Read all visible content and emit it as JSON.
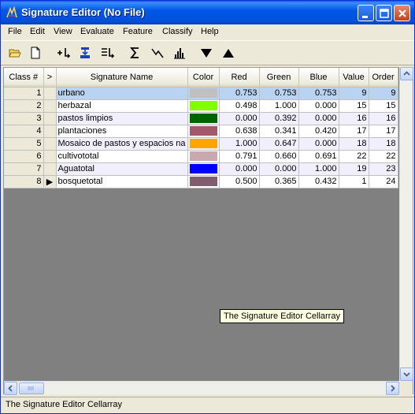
{
  "window": {
    "title": "Signature Editor (No File)",
    "icons": {
      "app": "signature-editor-app-icon",
      "minimize": "minimize-icon",
      "maximize": "maximize-icon",
      "close": "close-icon"
    }
  },
  "menu": [
    "File",
    "Edit",
    "View",
    "Evaluate",
    "Feature",
    "Classify",
    "Help"
  ],
  "toolbar": {
    "icons": [
      "open-folder-icon",
      "new-document-icon",
      "add-class-icon",
      "merge-icon",
      "replace-icon",
      "statistics-sigma-icon",
      "mean-plot-icon",
      "histogram-icon",
      "move-down-icon",
      "move-up-icon"
    ]
  },
  "grid": {
    "columns": [
      "Class #",
      ">",
      "Signature Name",
      "Color",
      "Red",
      "Green",
      "Blue",
      "Value",
      "Order"
    ],
    "rows": [
      {
        "class": "1",
        "marker": "",
        "name": "urbano",
        "color": "#C0C0C0",
        "red": "0.753",
        "green": "0.753",
        "blue": "0.753",
        "value": "9",
        "order": "9"
      },
      {
        "class": "2",
        "marker": "",
        "name": "herbazal",
        "color": "#7FFF00",
        "red": "0.498",
        "green": "1.000",
        "blue": "0.000",
        "value": "15",
        "order": "15"
      },
      {
        "class": "3",
        "marker": "",
        "name": "pastos limpios",
        "color": "#006400",
        "red": "0.000",
        "green": "0.392",
        "blue": "0.000",
        "value": "16",
        "order": "16"
      },
      {
        "class": "4",
        "marker": "",
        "name": "plantaciones",
        "color": "#A3576B",
        "red": "0.638",
        "green": "0.341",
        "blue": "0.420",
        "value": "17",
        "order": "17"
      },
      {
        "class": "5",
        "marker": "",
        "name": "Mosaico de pastos y espacios na",
        "color": "#FFA500",
        "red": "1.000",
        "green": "0.647",
        "blue": "0.000",
        "value": "18",
        "order": "18"
      },
      {
        "class": "6",
        "marker": "",
        "name": "cultivototal",
        "color": "#C9A8B0",
        "red": "0.791",
        "green": "0.660",
        "blue": "0.691",
        "value": "22",
        "order": "22"
      },
      {
        "class": "7",
        "marker": "",
        "name": "Aguatotal",
        "color": "#0000FF",
        "red": "0.000",
        "green": "0.000",
        "blue": "1.000",
        "value": "19",
        "order": "23"
      },
      {
        "class": "8",
        "marker": "▶",
        "name": "bosquetotal",
        "color": "#805D6E",
        "red": "0.500",
        "green": "0.365",
        "blue": "0.432",
        "value": "1",
        "order": "24"
      }
    ],
    "selected_row": 0
  },
  "tooltip": "The Signature Editor Cellarray",
  "status": "The Signature Editor Cellarray",
  "colors": {
    "titlebar": "#0058E6",
    "selection": "#B9D3F0",
    "grid_background": "#808080",
    "tooltip": "#FFFFE1"
  }
}
